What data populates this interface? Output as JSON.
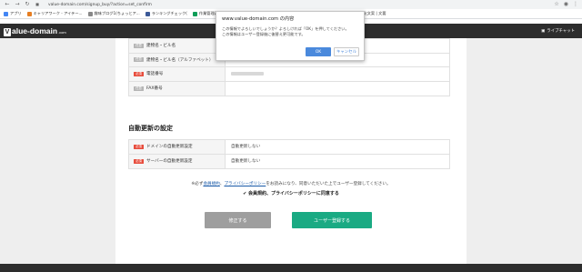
{
  "browser": {
    "url": "value-domain.com/signup_buy/?action=set_confirm",
    "bookmarks": [
      {
        "label": "アプリ",
        "color": "#4285f4"
      },
      {
        "label": "キャリアワーク - アイテー...",
        "color": "#e67e22"
      },
      {
        "label": "趣味ブログ1(ちょっとア...",
        "color": "#888888"
      },
      {
        "label": "ランキングチェック(",
        "color": "#3b5998"
      },
      {
        "label": "作業管理表 (",
        "color": "#0f9d58"
      },
      {
        "label": "HOME",
        "color": "#555555"
      },
      {
        "label": "Search Console - R...",
        "color": "#4285f4"
      },
      {
        "label": "goodkeyword - Goo...",
        "color": "#f4b400"
      },
      {
        "label": "強化文案 | 文要",
        "color": "#999999"
      }
    ]
  },
  "header": {
    "logo_v": "V",
    "logo_text": "alue-domain",
    "logo_suffix": ".com",
    "live_chat": "ライブチャット"
  },
  "form_rows": [
    {
      "badge": "任意",
      "badge_type": "opt",
      "label": "建物名・ビル名",
      "value": ""
    },
    {
      "badge": "任意",
      "badge_type": "opt",
      "label": "建物名・ビル名（アルファベット）",
      "value": ""
    },
    {
      "badge": "必須",
      "badge_type": "req",
      "label": "電話番号",
      "value": "",
      "blurred": true
    },
    {
      "badge": "任意",
      "badge_type": "opt",
      "label": "FAX番号",
      "value": ""
    }
  ],
  "renewal": {
    "title": "自動更新の設定",
    "rows": [
      {
        "badge": "必須",
        "label": "ドメインの自動更新設定",
        "value": "自動更新しない"
      },
      {
        "badge": "必須",
        "label": "サーバーの自動更新設定",
        "value": "自動更新しない"
      }
    ]
  },
  "notice": {
    "prefix": "※必ず",
    "terms_link": "会員規約",
    "separator": "、",
    "privacy_link": "プライバシーポリシー",
    "suffix": "をお読みになり、同意いただいた上でユーザー登録してください。"
  },
  "agreement": "✔ 会員規約、プライバシーポリシーに同意する",
  "buttons": {
    "back": "修正する",
    "register": "ユーザー登録する"
  },
  "dialog": {
    "title": "www.value-domain.com の内容",
    "line1": "この情報でよろしいでしょうか？よろしければ「OK」を押してください。",
    "line2": "この情報はユーザー登録後に後替え更可能です。",
    "ok": "OK",
    "cancel": "キャンセル"
  }
}
